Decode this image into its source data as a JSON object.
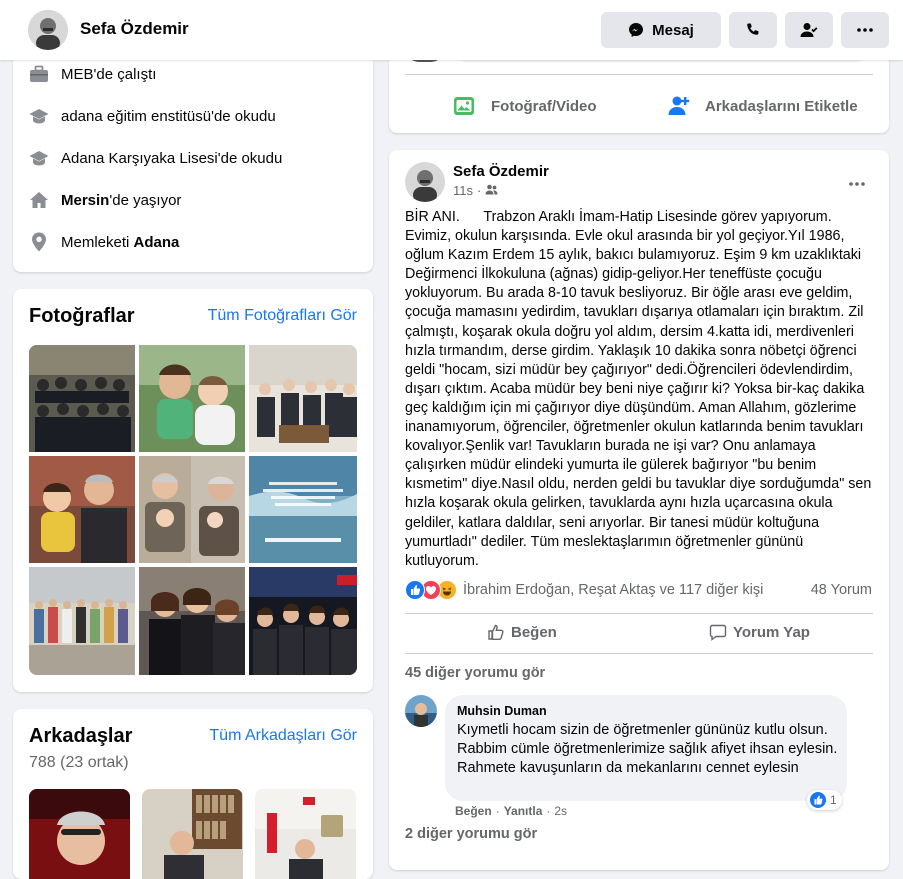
{
  "header": {
    "profile_name": "Sefa Özdemir",
    "message_label": "Mesaj"
  },
  "intro": {
    "work": "MEB'de çalıştı",
    "edu1": "adana eğitim enstitüsü'de okudu",
    "edu2": "Adana Karşıyaka Lisesi'de okudu",
    "lives_city": "Mersin",
    "lives_suffix": "'de yaşıyor",
    "hometown_prefix": "Memleketi ",
    "hometown_city": "Adana"
  },
  "photos": {
    "title": "Fotoğraflar",
    "see_all": "Tüm Fotoğrafları Gör"
  },
  "friends": {
    "title": "Arkadaşlar",
    "count": "788 (23 ortak)",
    "see_all": "Tüm Arkadaşları Gör"
  },
  "composer": {
    "photo_video": "Fotoğraf/Video",
    "tag_friends": "Arkadaşlarını Etiketle"
  },
  "post": {
    "author": "Sefa Özdemir",
    "time": "11s",
    "text": "BİR ANI.      Trabzon Araklı İmam-Hatip Lisesinde görev yapıyorum. Evimiz, okulun karşısında. Evle okul arasında bir yol geçiyor.Yıl 1986, oğlum Kazım Erdem 15 aylık, bakıcı bulamıyoruz. Eşim 9 km uzaklıktaki Değirmenci İlkokuluna (ağnas) gidip-geliyor.Her teneffüste çocuğu yokluyorum. Bu arada 8-10 tavuk besliyoruz. Bir öğle arası eve geldim, çocuğa mamasını yedirdim, tavukları dışarıya otlamaları için bıraktım. Zil çalmıştı, koşarak okula doğru yol aldım, dersim 4.katta idi, merdivenleri hızla tırmandım, derse girdim. Yaklaşık 10 dakika sonra nöbetçi öğrenci geldi \"hocam, sizi müdür bey çağırıyor\" dedi.Öğrencileri ödevlendirdim, dışarı çıktım. Acaba müdür bey beni niye çağırır ki? Yoksa bir-kaç dakika geç kaldığım için mi çağırıyor diye düşündüm. Aman Allahım, gözlerime inanamıyorum, öğrenciler, öğretmenler okulun katlarında benim tavukları kovalıyor.Şenlik var! Tavukların burada ne işi var? Onu anlamaya çalışırken müdür elindeki yumurta ile gülerek bağırıyor \"bu benim kısmetim\" diye.Nasıl oldu, nerden geldi bu tavuklar diye sorduğumda\" sen hızla koşarak okula gelirken, tavuklarda aynı hızla uçarcasına okula geldiler, katlara daldılar, seni arıyorlar. Bir tanesi müdür koltuğuna yumurtladı\" dediler. Tüm meslektaşlarımın öğretmenler gününü kutluyorum.",
    "reactions_text": "İbrahim Erdoğan, Reşat Aktaş ve 117 diğer kişi",
    "comments_count": "48 Yorum",
    "like_label": "Beğen",
    "comment_label": "Yorum Yap",
    "more_comments": "45 diğer yorumu gör",
    "more_comments2": "2 diğer yorumu gör"
  },
  "comment": {
    "author": "Muhsin Duman",
    "text": "Kıymetli hocam sizin de öğretmenler gününüz kutlu olsun. Rabbim cümle öğretmenlerimize sağlık afiyet ihsan eylesin. Rahmete kavuşunların da mekanlarını cennet eylesin",
    "like": "Beğen",
    "reply": "Yanıtla",
    "time": "2s",
    "reaction_count": "1"
  },
  "colors": {
    "accent": "#1877f2",
    "background": "#f0f2f5",
    "secondary_text": "#65676b"
  }
}
